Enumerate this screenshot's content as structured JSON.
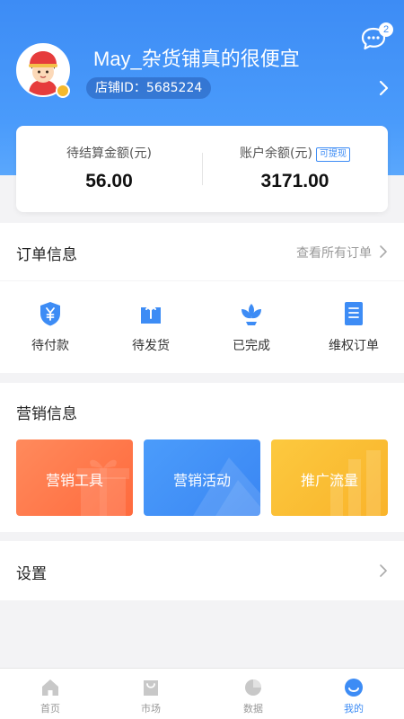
{
  "header": {
    "message_badge": "2",
    "shop_name": "May_杂货铺真的很便宜",
    "shop_id": "店铺ID：5685224"
  },
  "balance": {
    "pending_label": "待结算金额(元)",
    "pending_value": "56.00",
    "account_label": "账户余额(元)",
    "withdraw_tag": "可提现",
    "account_value": "3171.00"
  },
  "orders": {
    "title": "订单信息",
    "view_all": "查看所有订单",
    "items": [
      {
        "label": "待付款",
        "icon": "yuan-shield-icon"
      },
      {
        "label": "待发货",
        "icon": "box-upload-icon"
      },
      {
        "label": "已完成",
        "icon": "lotus-icon"
      },
      {
        "label": "维权订单",
        "icon": "document-list-icon"
      }
    ]
  },
  "marketing": {
    "title": "营销信息",
    "cards": [
      {
        "label": "营销工具",
        "color": "#ff7a4f"
      },
      {
        "label": "营销活动",
        "color": "#3c8df5"
      },
      {
        "label": "推广流量",
        "color": "#fbbf31"
      }
    ]
  },
  "settings": {
    "title": "设置"
  },
  "tabbar": {
    "items": [
      {
        "label": "首页",
        "icon": "home-icon"
      },
      {
        "label": "市场",
        "icon": "shopping-bag-icon"
      },
      {
        "label": "数据",
        "icon": "pie-chart-icon"
      },
      {
        "label": "我的",
        "icon": "profile-icon"
      }
    ],
    "active_index": 3
  },
  "colors": {
    "brand_blue": "#3d8cf5",
    "page_bg": "#f3f3f5"
  }
}
